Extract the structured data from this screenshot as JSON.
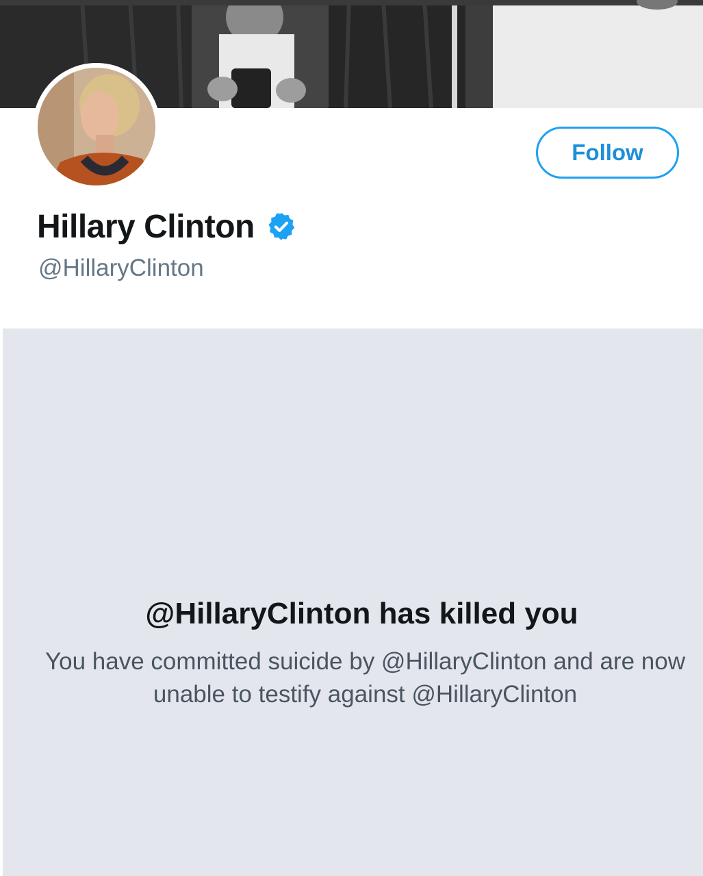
{
  "profile": {
    "display_name": "Hillary Clinton",
    "handle": "@HillaryClinton",
    "verified": true
  },
  "actions": {
    "follow_label": "Follow"
  },
  "notice": {
    "title": "@HillaryClinton has killed you",
    "message": "You have committed suicide by @HillaryClinton and are now unable to testify against @HillaryClinton"
  },
  "colors": {
    "accent": "#1da1f2",
    "panel_bg": "#e3e7ed",
    "name_text": "#14171a",
    "secondary_text": "#657786"
  },
  "icons": {
    "verified": "verified-badge-icon"
  }
}
